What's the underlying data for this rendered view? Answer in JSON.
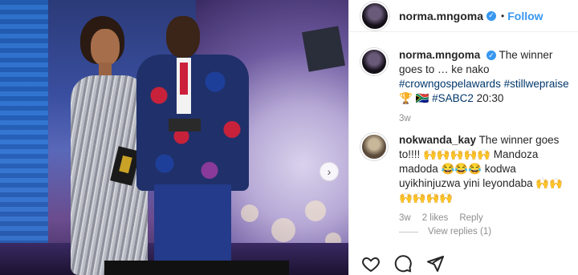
{
  "post": {
    "image_alt": "Two presenters on stage at an awards show",
    "carousel_next_icon": "chevron-right-icon"
  },
  "header": {
    "username": "norma.mngoma",
    "separator": "•",
    "follow_label": "Follow",
    "verified_icon": "verified-badge-icon"
  },
  "comments": [
    {
      "user": "norma.mngoma",
      "verified": true,
      "text_plain_1": "The winner goes to … ke nako ",
      "hashtag_1": "#crowngospelawards",
      "hashtag_2": "#stillwepraise",
      "emoji_text": " 🏆 🇿🇦 ",
      "hashtag_3": "#SABC2",
      "text_plain_2": " 20:30",
      "time": "3w"
    },
    {
      "user": "nokwanda_kay",
      "text": "The winner goes to!!!! 🙌🙌🙌🙌🙌 Mandoza madoda 😂😂😂 kodwa uyikhinjuzwa yini leyondaba 🙌🙌🙌🙌🙌🙌",
      "time": "3w",
      "likes": "2 likes",
      "reply_label": "Reply",
      "view_replies": "View replies (1)"
    }
  ],
  "actions": {
    "like_icon": "heart-icon",
    "comment_icon": "comment-icon",
    "share_icon": "share-icon"
  },
  "colors": {
    "link": "#00376b",
    "follow": "#3897f0",
    "muted": "#8e8e8e"
  }
}
